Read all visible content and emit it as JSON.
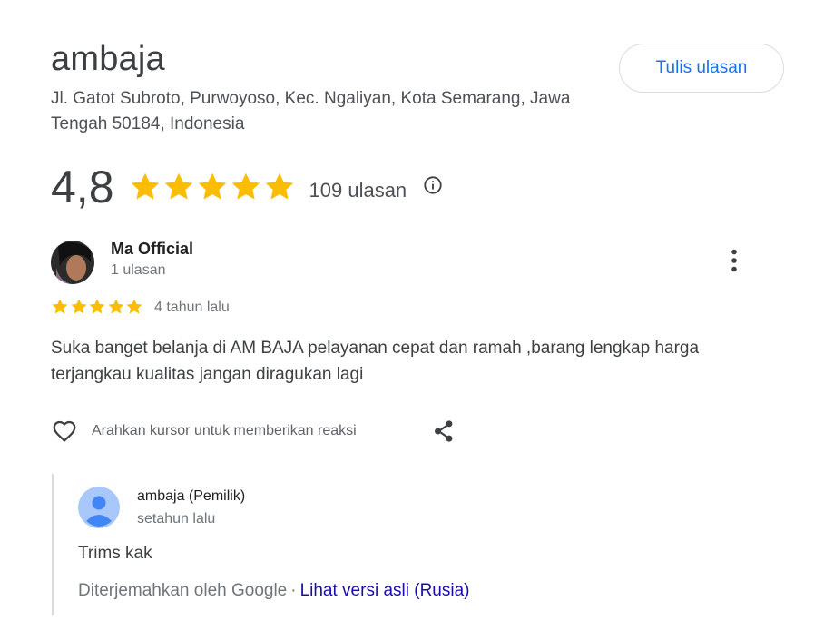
{
  "place": {
    "name": "ambaja",
    "address": "Jl. Gatot Subroto, Purwoyoso, Kec. Ngaliyan, Kota Semarang, Jawa Tengah 50184, Indonesia"
  },
  "actions": {
    "write_review_label": "Tulis ulasan"
  },
  "rating": {
    "value": "4,8",
    "stars": 5,
    "count_label": "109 ulasan",
    "star_color": "#fbbc04",
    "info_icon": "info-icon"
  },
  "review": {
    "author": "Ma Official",
    "author_reviews": "1 ulasan",
    "stars": 5,
    "date": "4 tahun lalu",
    "text": "Suka banget belanja di AM BAJA pelayanan cepat dan ramah ,barang lengkap harga terjangkau kualitas jangan diragukan lagi",
    "react_label": "Arahkan kursor untuk memberikan reaksi",
    "icons": [
      "heart-icon",
      "share-icon",
      "more-vert-icon"
    ]
  },
  "owner_reply": {
    "author": "ambaja (Pemilik)",
    "date": "setahun lalu",
    "text": "Trims kak",
    "translated_by": "Diterjemahkan oleh Google",
    "separator": "·",
    "original_link": "Lihat versi asli (Rusia)",
    "link_color": "#1a0dab"
  }
}
